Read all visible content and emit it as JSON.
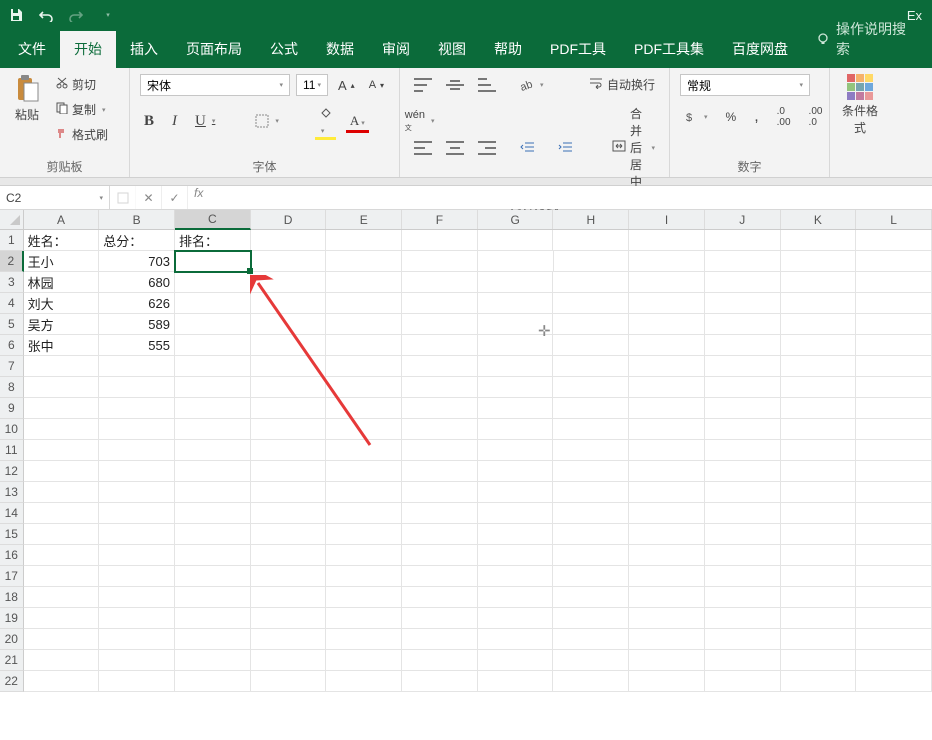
{
  "app": {
    "name": "Ex"
  },
  "tabs": {
    "file": "文件",
    "home": "开始",
    "insert": "插入",
    "layout": "页面布局",
    "formulas": "公式",
    "data": "数据",
    "review": "审阅",
    "view": "视图",
    "help": "帮助",
    "pdf_tool": "PDF工具",
    "pdf_toolset": "PDF工具集",
    "baidu": "百度网盘",
    "tellme_placeholder": "操作说明搜索"
  },
  "ribbon": {
    "clipboard": {
      "paste": "粘贴",
      "cut": "剪切",
      "copy": "复制",
      "format_painter": "格式刷",
      "group_title": "剪贴板"
    },
    "font": {
      "font_name": "宋体",
      "font_size": "11",
      "group_title": "字体"
    },
    "alignment": {
      "wrap": "自动换行",
      "merge": "合并后居中",
      "group_title": "对齐方式"
    },
    "number": {
      "format": "常规",
      "group_title": "数字"
    },
    "styles": {
      "conditional_format": "条件格式"
    }
  },
  "formula_bar": {
    "cell_ref": "C2",
    "formula": ""
  },
  "columns": [
    "A",
    "B",
    "C",
    "D",
    "E",
    "F",
    "G",
    "H",
    "I",
    "J",
    "K",
    "L"
  ],
  "headers": {
    "A1": "姓名：",
    "B1": "总分：",
    "C1": "排名："
  },
  "rows_data": [
    {
      "name": "王小",
      "score": "703"
    },
    {
      "name": "林园",
      "score": "680"
    },
    {
      "name": "刘大",
      "score": "626"
    },
    {
      "name": "吴方",
      "score": "589"
    },
    {
      "name": "张中",
      "score": "555"
    }
  ],
  "selected_cell": "C2",
  "row_count": 22
}
